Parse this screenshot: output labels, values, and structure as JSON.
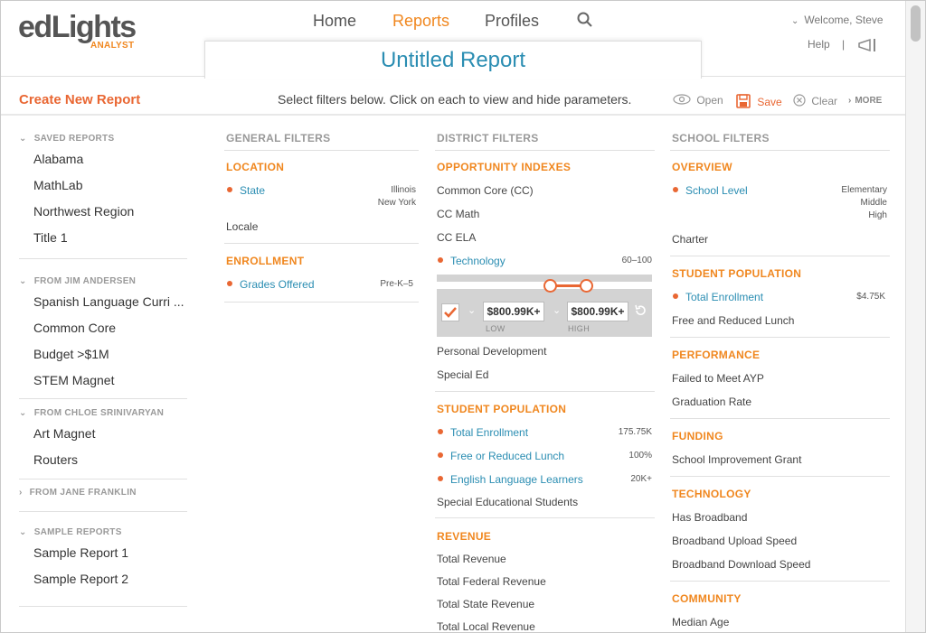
{
  "brand": {
    "name_prefix": "ed",
    "name_suffix": "Lights",
    "tagline": "ANALYST"
  },
  "nav": {
    "home": "Home",
    "reports": "Reports",
    "profiles": "Profiles"
  },
  "user": {
    "welcome": "Welcome, Steve",
    "help": "Help",
    "separator": "|"
  },
  "report": {
    "title": "Untitled Report"
  },
  "toolbar": {
    "create_new": "Create New Report",
    "instructions": "Select filters below. Click on each to view and hide parameters.",
    "open": "Open",
    "save": "Save",
    "clear": "Clear",
    "more": "MORE"
  },
  "sidebar": {
    "saved": {
      "heading": "SAVED REPORTS",
      "items": [
        "Alabama",
        "MathLab",
        "Northwest Region",
        "Title 1"
      ]
    },
    "jim": {
      "heading": "FROM JIM ANDERSEN",
      "items": [
        "Spanish Language Curri ...",
        "Common Core",
        "Budget >$1M",
        "STEM Magnet"
      ]
    },
    "chloe": {
      "heading": "FROM CHLOE SRINIVARYAN",
      "items": [
        "Art Magnet",
        "Routers"
      ]
    },
    "jane": {
      "heading": "FROM JANE FRANKLIN"
    },
    "sample": {
      "heading": "SAMPLE REPORTS",
      "items": [
        "Sample Report 1",
        "Sample Report 2"
      ]
    }
  },
  "general": {
    "heading": "GENERAL FILTERS",
    "location": {
      "heading": "LOCATION",
      "state": "State",
      "state_values": [
        "Illinois",
        "New York"
      ],
      "locale": "Locale"
    },
    "enrollment": {
      "heading": "ENROLLMENT",
      "grades": "Grades Offered",
      "grades_value": "Pre-K–5"
    }
  },
  "district": {
    "heading": "DISTRICT FILTERS",
    "opportunity": {
      "heading": "OPPORTUNITY INDEXES",
      "items": [
        "Common Core (CC)",
        "CC Math",
        "CC ELA"
      ],
      "technology": "Technology",
      "technology_value": "60–100",
      "after": [
        "Personal Development",
        "Special Ed"
      ]
    },
    "params": {
      "low": "$800.99K+",
      "high": "$800.99K+",
      "low_label": "LOW",
      "high_label": "HIGH",
      "slider_low_fraction": 0.6,
      "slider_high_fraction": 0.7
    },
    "population": {
      "heading": "STUDENT POPULATION",
      "total": "Total Enrollment",
      "total_value": "175.75K",
      "lunch": "Free or Reduced Lunch",
      "lunch_value": "100%",
      "ell": "English Language Learners",
      "ell_value": "20K+",
      "special": "Special Educational Students"
    },
    "revenue": {
      "heading": "REVENUE",
      "items": [
        "Total Revenue",
        "Total Federal Revenue",
        "Total State Revenue",
        "Total Local Revenue"
      ]
    }
  },
  "school": {
    "heading": "SCHOOL FILTERS",
    "overview": {
      "heading": "OVERVIEW",
      "level": "School Level",
      "level_values": [
        "Elementary",
        "Middle",
        "High"
      ],
      "charter": "Charter"
    },
    "population": {
      "heading": "STUDENT POPULATION",
      "total": "Total Enrollment",
      "total_value": "$4.75K",
      "lunch": "Free and Reduced Lunch"
    },
    "performance": {
      "heading": "PERFORMANCE",
      "items": [
        "Failed to Meet AYP",
        "Graduation Rate"
      ]
    },
    "funding": {
      "heading": "FUNDING",
      "items": [
        "School Improvement Grant"
      ]
    },
    "technology": {
      "heading": "TECHNOLOGY",
      "items": [
        "Has Broadband",
        "Broadband Upload Speed",
        "Broadband Download Speed"
      ]
    },
    "community": {
      "heading": "COMMUNITY",
      "items": [
        "Median Age"
      ]
    }
  }
}
